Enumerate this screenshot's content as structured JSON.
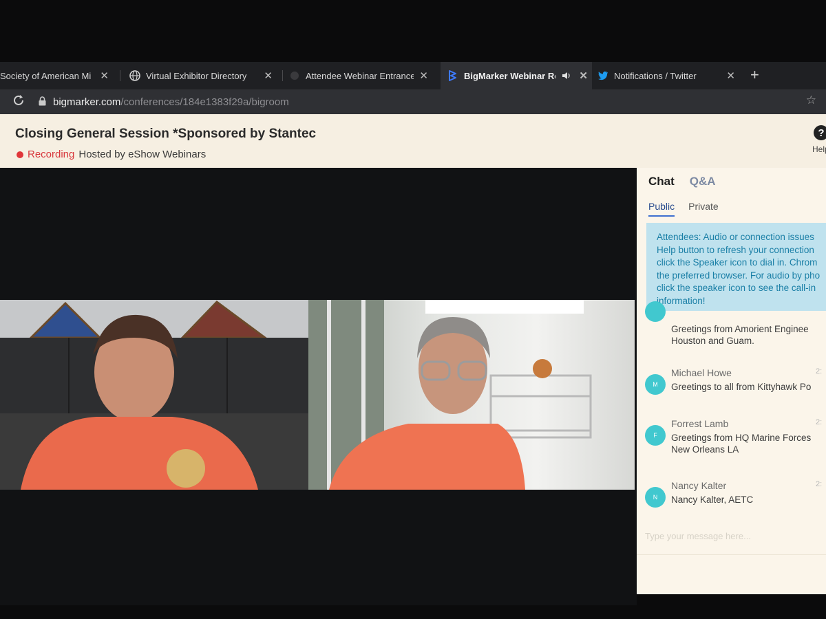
{
  "browser": {
    "tabs": [
      {
        "title": "Society of American Mi",
        "active": false,
        "icon": "generic-tab-icon"
      },
      {
        "title": "Virtual Exhibitor Directory",
        "active": false,
        "icon": "globe-icon"
      },
      {
        "title": "Attendee Webinar Entrance",
        "active": false,
        "icon": "site-icon"
      },
      {
        "title": "BigMarker Webinar Roo",
        "active": true,
        "icon": "bigmarker-icon",
        "audio": "speaker-icon"
      },
      {
        "title": "Notifications / Twitter",
        "active": false,
        "icon": "twitter-icon"
      }
    ],
    "close_glyph": "✕",
    "new_tab_glyph": "+",
    "url_host": "bigmarker.com",
    "url_path": "/conferences/184e1383f29a/bigroom",
    "colors": {
      "tabbar": "#1f2023",
      "toolbar": "#2f3034",
      "twitter": "#1d9bf0",
      "bigmarker": "#3e7bff"
    }
  },
  "header": {
    "title": "Closing General Session *Sponsored by Stantec",
    "recording_label": "Recording",
    "host_text": "Hosted by eShow Webinars",
    "help_glyph": "?",
    "help_label": "Help",
    "colors": {
      "recording": "#e0363a",
      "background": "#f6efe2"
    }
  },
  "chat": {
    "tabs": [
      {
        "label": "Chat",
        "active": true
      },
      {
        "label": "Q&A",
        "active": false
      }
    ],
    "sub_tabs": [
      {
        "label": "Public",
        "active": true
      },
      {
        "label": "Private",
        "active": false
      }
    ],
    "notice_lines": [
      "Attendees: Audio or connection issues",
      "Help button to refresh your connection",
      "click the Speaker icon to dial in. Chrom",
      "the preferred browser. For audio by pho",
      "click the speaker icon to see the call-in",
      "information!"
    ],
    "messages": [
      {
        "author": "",
        "initial": "",
        "lines": [
          "Greetings from Amorient Enginee",
          "Houston and Guam."
        ],
        "time": ""
      },
      {
        "author": "Michael Howe",
        "initial": "M",
        "lines": [
          "Greetings to all from Kittyhawk Po"
        ],
        "time": "2:"
      },
      {
        "author": "Forrest Lamb",
        "initial": "F",
        "lines": [
          "Greetings from HQ Marine Forces",
          "New Orleans LA"
        ],
        "time": "2:"
      },
      {
        "author": "Nancy Kalter",
        "initial": "N",
        "lines": [
          "Nancy Kalter, AETC"
        ],
        "time": "2:"
      }
    ],
    "composer_placeholder": "Type your message here...",
    "colors": {
      "avatar": "#41c8cf",
      "notice_bg": "#bfe2ee",
      "notice_text": "#1a7fa6"
    }
  }
}
